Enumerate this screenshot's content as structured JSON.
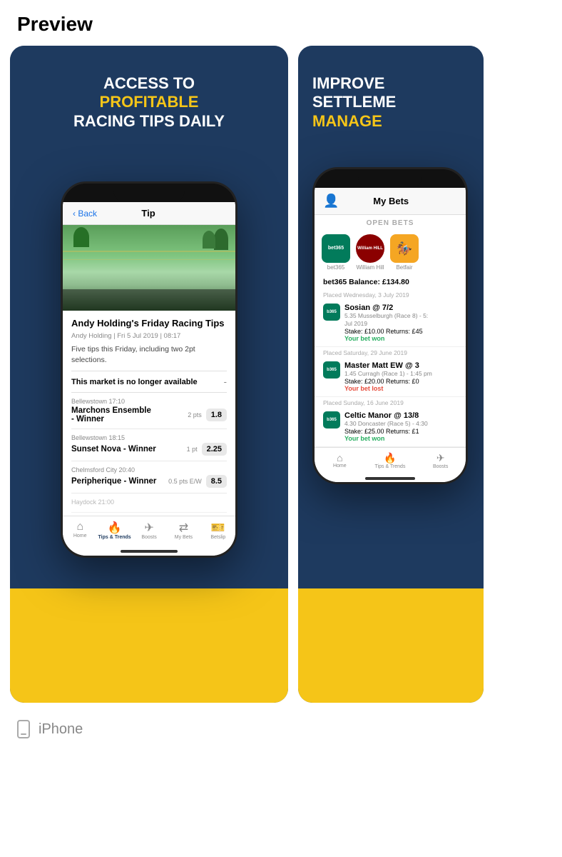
{
  "page": {
    "title": "Preview"
  },
  "card_left": {
    "headline_line1": "ACCESS TO",
    "headline_highlight": "PROFITABLE",
    "headline_line3": "RACING TIPS DAILY",
    "phone": {
      "header": {
        "back_label": "Back",
        "screen_title": "Tip"
      },
      "article": {
        "title": "Andy Holding's Friday Racing Tips",
        "meta": "Andy Holding | Fri 5 Jul 2019 | 08:17",
        "description": "Five tips this Friday, including two 2pt selections."
      },
      "market_row": {
        "label": "This market is no longer available",
        "value": "-"
      },
      "tips": [
        {
          "venue": "Bellewstown 17:10",
          "horse": "Marchons Ensemble - Winner",
          "pts": "2 pts",
          "odds": "1.8"
        },
        {
          "venue": "Bellewstown 18:15",
          "horse": "Sunset Nova - Winner",
          "pts": "1 pt",
          "odds": "2.25"
        },
        {
          "venue": "Chelmsford City 20:40",
          "horse": "Peripherique - Winner",
          "pts": "0.5 pts E/W",
          "odds": "8.5"
        },
        {
          "venue": "Haydock 21:00",
          "horse": "",
          "pts": "",
          "odds": ""
        }
      ],
      "nav": [
        {
          "label": "Home",
          "icon": "🏠",
          "active": false
        },
        {
          "label": "Tips & Trends",
          "icon": "🔥",
          "active": true
        },
        {
          "label": "Boosts",
          "icon": "🚀",
          "active": false
        },
        {
          "label": "My Bets",
          "icon": "⇄",
          "active": false
        },
        {
          "label": "Betslip",
          "icon": "🎫",
          "active": false
        }
      ]
    }
  },
  "card_right": {
    "headline_line1": "IMPROVE",
    "headline_line2": "SETTLEME",
    "headline_highlight": "MANAGE",
    "phone": {
      "header": {
        "screen_title": "My Bets"
      },
      "open_bets_label": "OPEN BETS",
      "bookmakers": [
        {
          "name": "bet365",
          "bg": "#027b5b",
          "text_color": "#fff",
          "abbr": "bet365"
        },
        {
          "name": "William Hill",
          "bg": "#1a1a2e",
          "text_color": "#fff",
          "abbr": "William\nHill"
        },
        {
          "name": "Betfair",
          "bg": "#f5a623",
          "text_color": "#fff",
          "abbr": "🏇"
        }
      ],
      "balance": "bet365 Balance: £134.80",
      "bets": [
        {
          "date": "Placed Wednesday, 3 July 2019",
          "horse": "Sosian @ 7/2",
          "race": "5.35 Musselburgh (Race 8) - 5 Jul 2019",
          "stake": "Stake: £10.00  Returns: £45",
          "result": "Your bet won",
          "won": true
        },
        {
          "date": "Placed Saturday, 29 June 2019",
          "horse": "Master Matt EW @ 3",
          "race": "1.45 Curragh (Race 1) - 1:45 pm",
          "stake": "Stake: £20.00  Returns: £0",
          "result": "Your bet lost",
          "won": false
        },
        {
          "date": "Placed Sunday, 16 June 2019",
          "horse": "Celtic Manor @ 13/8",
          "race": "4.30 Doncaster (Race 5) - 4:30",
          "stake": "Stake: £25.00  Returns: £1",
          "result": "Your bet won",
          "won": true
        }
      ],
      "nav": [
        {
          "label": "Home",
          "icon": "🏠",
          "active": false
        },
        {
          "label": "Tips & Trends",
          "icon": "🔥",
          "active": false
        },
        {
          "label": "Boosts",
          "icon": "🚀",
          "active": false
        }
      ]
    }
  },
  "device_label": "iPhone"
}
